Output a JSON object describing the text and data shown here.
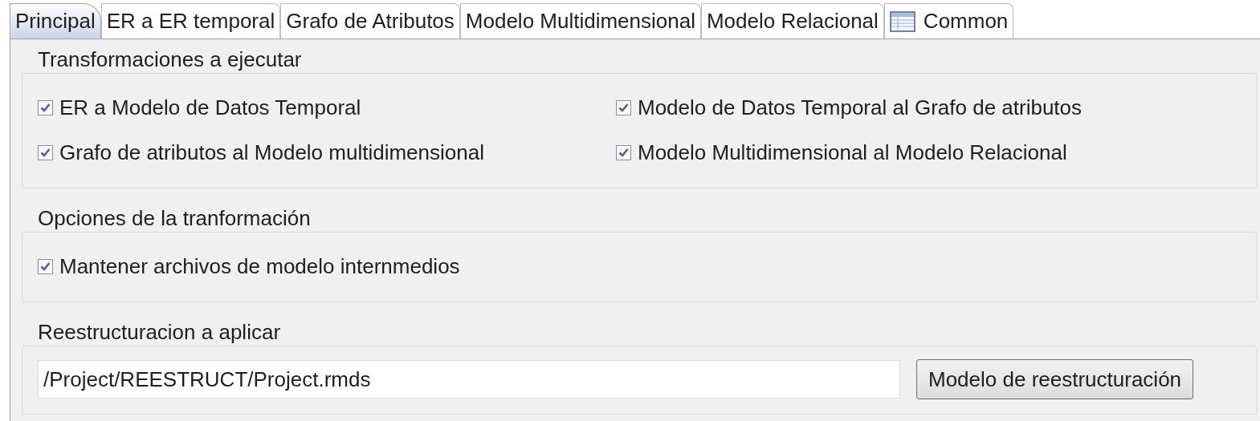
{
  "tabs": [
    {
      "label": "Principal",
      "selected": true,
      "kind": "text"
    },
    {
      "label": "ER a ER temporal",
      "selected": false,
      "kind": "text"
    },
    {
      "label": "Grafo de Atributos",
      "selected": false,
      "kind": "text"
    },
    {
      "label": "Modelo Multidimensional",
      "selected": false,
      "kind": "text"
    },
    {
      "label": "Modelo Relacional",
      "selected": false,
      "kind": "text"
    },
    {
      "label": "Common",
      "selected": false,
      "kind": "table"
    }
  ],
  "groups": [
    {
      "title": "Transformaciones a ejecutar",
      "kind": "checkboxes",
      "options": [
        {
          "label": "ER a Modelo de Datos Temporal",
          "checked": true
        },
        {
          "label": "Modelo de Datos Temporal al Grafo de atributos",
          "checked": true
        },
        {
          "label": "Grafo de atributos al Modelo multidimensional",
          "checked": true
        },
        {
          "label": "Modelo Multidimensional al Modelo Relacional",
          "checked": true
        }
      ]
    },
    {
      "title": "Opciones de la tranformación",
      "kind": "checkboxes",
      "options": [
        {
          "label": "Mantener archivos de modelo internmedios",
          "checked": true
        }
      ]
    },
    {
      "title": "Reestructuracion a aplicar",
      "kind": "file",
      "value": "/Project/REESTRUCT/Project.rmds",
      "button": "Modelo de reestructuración"
    }
  ]
}
